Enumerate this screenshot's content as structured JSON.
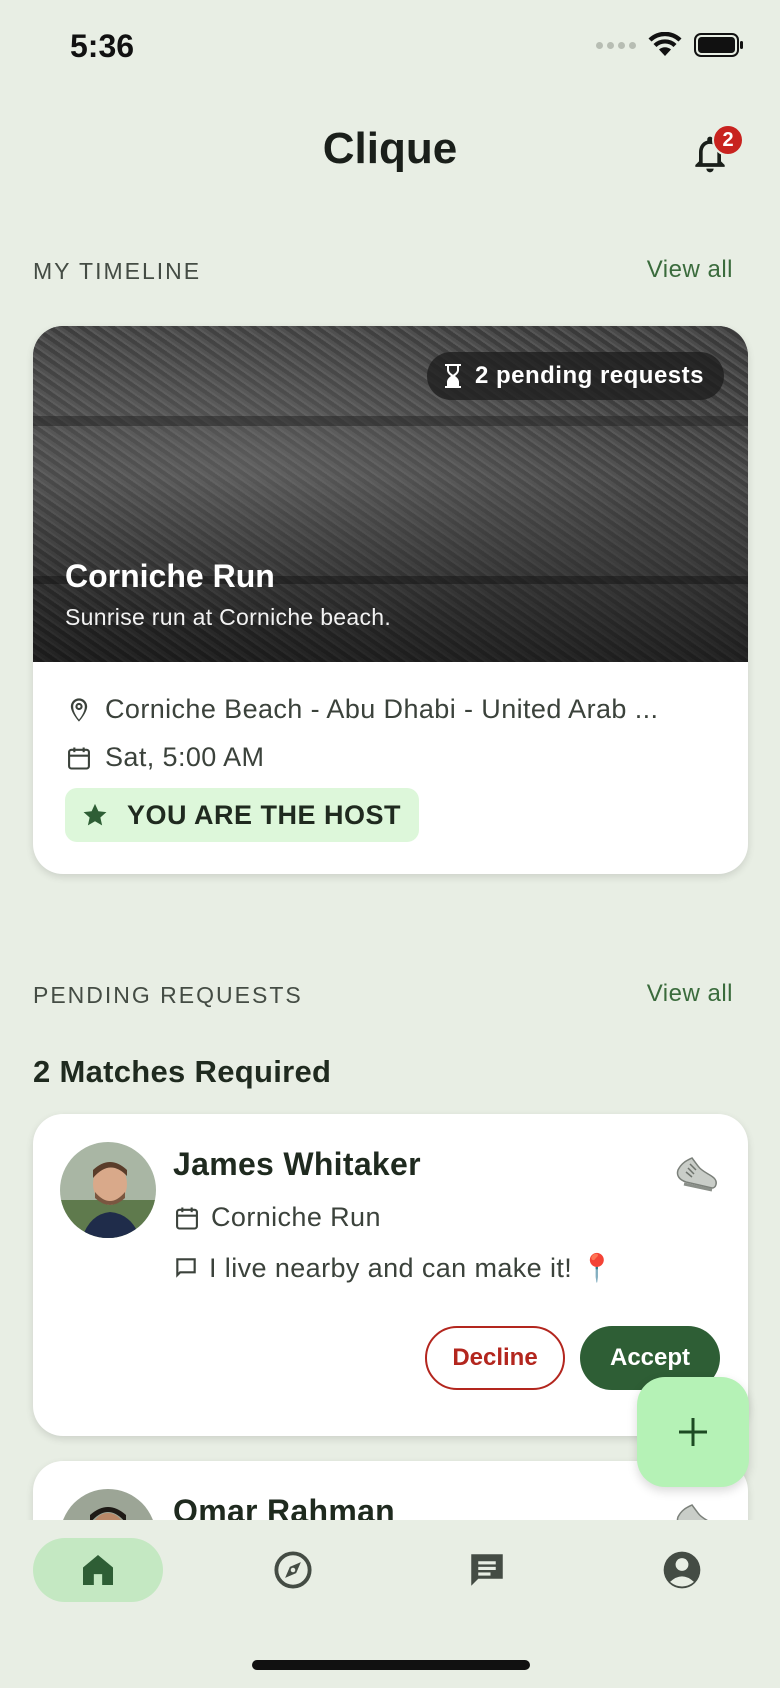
{
  "status_bar": {
    "time": "5:36"
  },
  "header": {
    "title": "Clique",
    "notification_count": "2"
  },
  "timeline": {
    "section_title": "MY TIMELINE",
    "view_all": "View all",
    "event": {
      "pending_label": "2 pending requests",
      "title": "Corniche Run",
      "subtitle": "Sunrise run at Corniche beach.",
      "location": "Corniche Beach - Abu Dhabi - United Arab ...",
      "datetime": "Sat, 5:00 AM",
      "host_badge": "YOU ARE THE HOST"
    }
  },
  "pending": {
    "section_title": "PENDING REQUESTS",
    "view_all": "View all",
    "matches_title": "2 Matches Required",
    "requests": [
      {
        "name": "James Whitaker",
        "event": "Corniche Run",
        "message": "I live nearby and can make it! 📍",
        "decline_label": "Decline",
        "accept_label": "Accept"
      },
      {
        "name": "Omar Rahman"
      }
    ]
  },
  "bottom_nav": {
    "items": [
      {
        "icon": "home-icon",
        "active": true
      },
      {
        "icon": "compass-icon",
        "active": false
      },
      {
        "icon": "chat-icon",
        "active": false
      },
      {
        "icon": "account-icon",
        "active": false
      }
    ]
  },
  "colors": {
    "background": "#e8eee4",
    "primary": "#2e5e35",
    "accent_light": "#b5f2b6",
    "danger": "#b3261e",
    "badge": "#c8231f"
  }
}
